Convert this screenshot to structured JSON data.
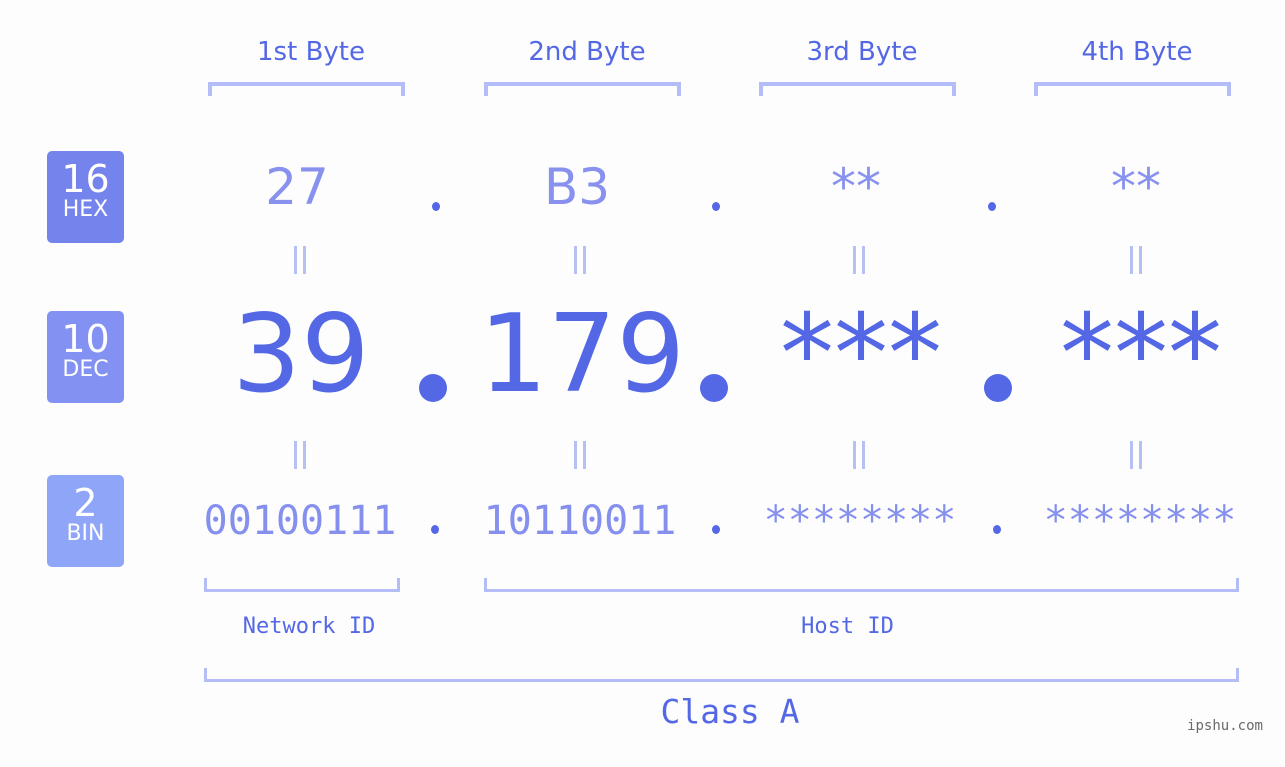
{
  "bytes": [
    {
      "header": "1st Byte",
      "hex": "27",
      "dec": "39",
      "bin": "00100111"
    },
    {
      "header": "2nd Byte",
      "hex": "B3",
      "dec": "179",
      "bin": "10110011"
    },
    {
      "header": "3rd Byte",
      "hex": "**",
      "dec": "***",
      "bin": "********"
    },
    {
      "header": "4th Byte",
      "hex": "**",
      "dec": "***",
      "bin": "********"
    }
  ],
  "bases": {
    "hex": {
      "number": "16",
      "label": "HEX"
    },
    "dec": {
      "number": "10",
      "label": "DEC"
    },
    "bin": {
      "number": "2",
      "label": "BIN"
    }
  },
  "segments": {
    "network_id": "Network ID",
    "host_id": "Host ID",
    "ip_class": "Class A"
  },
  "watermark": "ipshu.com",
  "colors": {
    "primary": "#5468e6",
    "bracket": "#b5bdf8",
    "hex_badge": "#7583ed",
    "dec_badge": "#8392f2",
    "bin_badge": "#8fa6f8",
    "background": "#fcfdfc"
  }
}
